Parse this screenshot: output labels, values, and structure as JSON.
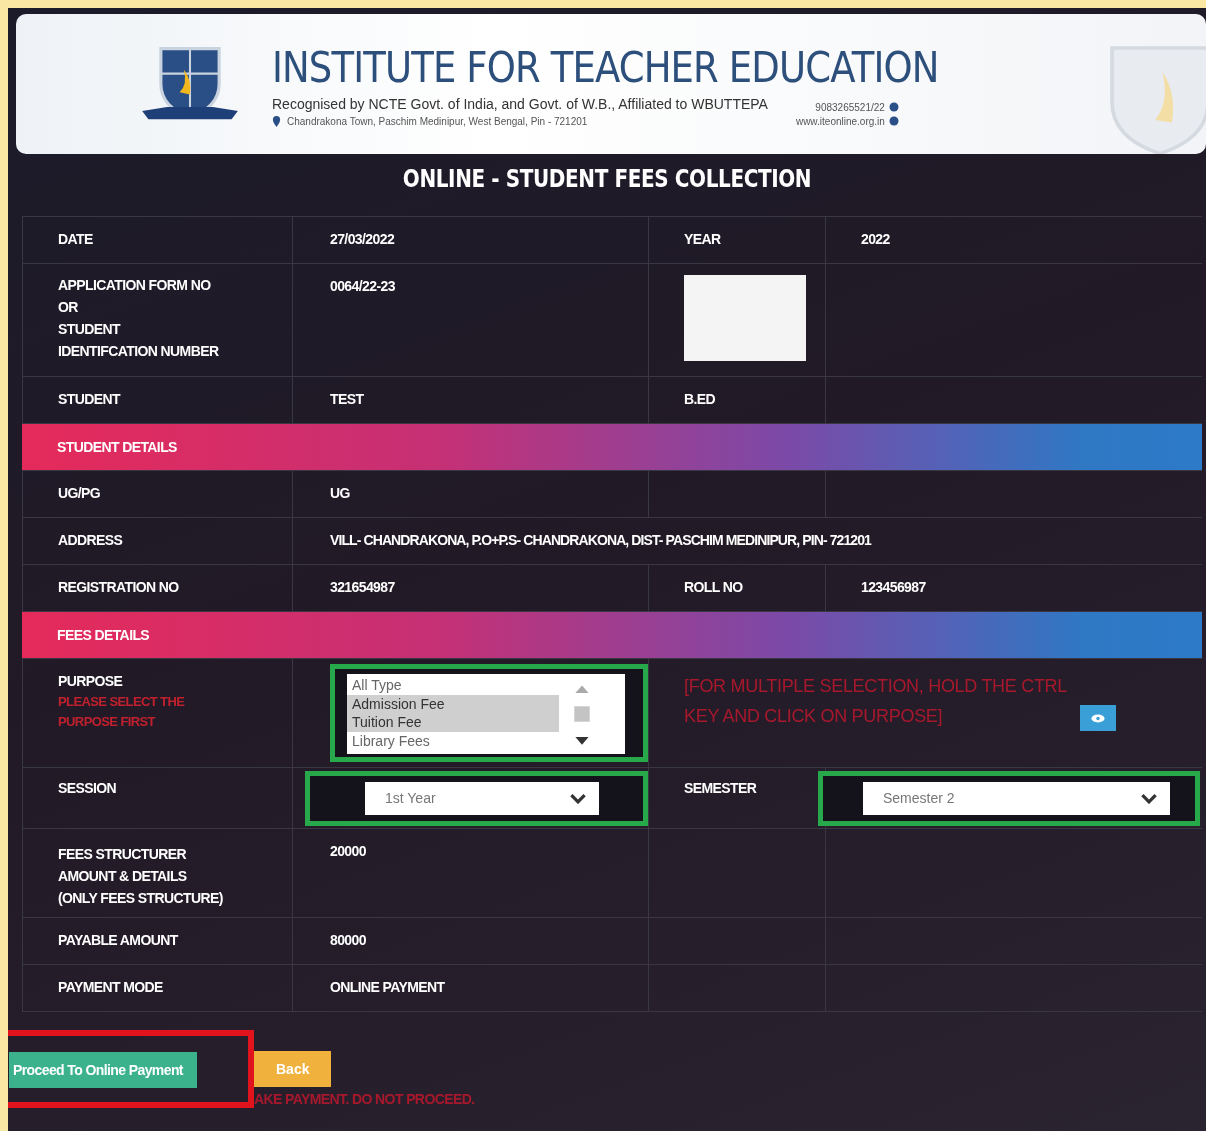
{
  "header": {
    "title": "INSTITUTE FOR TEACHER EDUCATION",
    "subtitle": "Recognised by NCTE Govt. of India, and Govt. of W.B., Affiliated to WBUTTEPA",
    "address": "Chandrakona Town, Paschim Medinipur, West Bengal, Pin - 721201",
    "phone": "9083265521/22",
    "website": "www.iteonline.org.in"
  },
  "page_title": "ONLINE - STUDENT FEES COLLECTION",
  "rows": [
    {
      "kind": "pair",
      "label": "DATE",
      "value": "27/03/2022",
      "label2": "YEAR",
      "value2": "2022"
    },
    {
      "kind": "photo",
      "label_lines": [
        "APPLICATION FORM NO",
        "OR",
        "STUDENT",
        "IDENTIFCATION NUMBER"
      ],
      "value": "0064/22-23"
    },
    {
      "kind": "pair",
      "label": "STUDENT",
      "value": "TEST",
      "label2": "B.ED",
      "value2": ""
    },
    {
      "kind": "band",
      "label": "STUDENT DETAILS"
    },
    {
      "kind": "pair",
      "label": "UG/PG",
      "value": "UG",
      "label2": "",
      "value2": ""
    },
    {
      "kind": "wide",
      "label": "ADDRESS",
      "value": "VILL- CHANDRAKONA, P.O+P.S- CHANDRAKONA, DIST- PASCHIM MEDINIPUR, PIN- 721201"
    },
    {
      "kind": "pair",
      "label": "REGISTRATION NO",
      "value": "321654987",
      "label2": "ROLL NO",
      "value2": "123456987"
    },
    {
      "kind": "band",
      "label": "FEES DETAILS"
    },
    {
      "kind": "purpose",
      "label": "PURPOSE",
      "hint": "PLEASE SELECT THE PURPOSE FIRST",
      "options": [
        {
          "label": "All Type",
          "selected": false
        },
        {
          "label": "Admission Fee",
          "selected": true
        },
        {
          "label": "Tuition Fee",
          "selected": true
        },
        {
          "label": "Library Fees",
          "selected": false
        }
      ],
      "help_text": "[FOR MULTIPLE SELECTION, HOLD THE CTRL KEY AND CLICK ON PURPOSE]"
    },
    {
      "kind": "selects",
      "label": "SESSION",
      "value": "1st Year",
      "label2": "SEMESTER",
      "value2": "Semester 2"
    },
    {
      "kind": "lines",
      "label_lines": [
        "FEES STRUCTURER",
        "AMOUNT & DETAILS",
        "(ONLY FEES STRUCTURE)"
      ],
      "value": "20000"
    },
    {
      "kind": "pair",
      "label": "PAYABLE AMOUNT",
      "value": "80000",
      "label2": "",
      "value2": ""
    },
    {
      "kind": "pair",
      "label": "PAYMENT MODE",
      "value": "ONLINE PAYMENT",
      "label2": "",
      "value2": ""
    }
  ],
  "buttons": {
    "proceed": "Proceed To Online Payment",
    "back": "Back"
  },
  "note": "AKE PAYMENT. DO NOT PROCEED."
}
